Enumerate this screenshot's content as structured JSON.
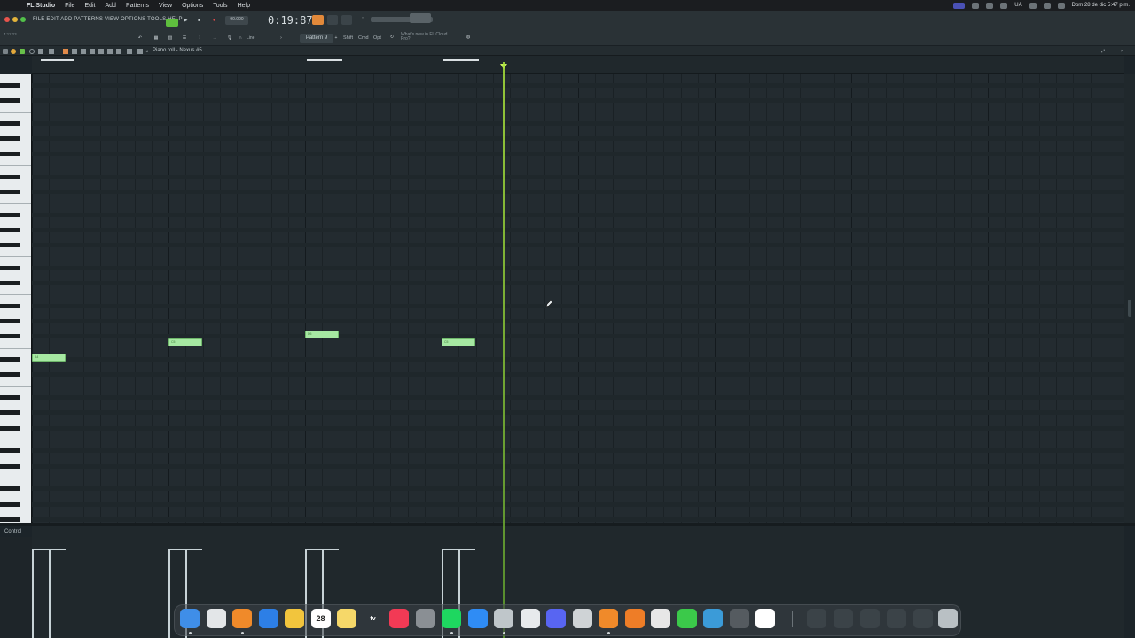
{
  "menubar": {
    "apple": "",
    "app_name": "FL Studio",
    "items": [
      "File",
      "Edit",
      "Add",
      "Patterns",
      "View",
      "Options",
      "Tools",
      "Help"
    ],
    "right_text": "UA",
    "datetime": "Dom 28 de dic 5:47 p.m."
  },
  "toolbar": {
    "fl_menu": "FILE  EDIT  ADD  PATTERNS  VIEW  OPTIONS  TOOLS  HELP",
    "tempo": "90.000",
    "time": "0:19:87",
    "snap": "Line",
    "pattern": "Pattern 9",
    "mode_shift": "Shift",
    "mode_cmd": "Cmd",
    "mode_opt": "Opt",
    "news": "What's new in FL Cloud Pro?",
    "file_path": "4:11:23"
  },
  "piano_roll": {
    "title": "Piano roll - Nexus #5",
    "control_label": "Control",
    "playhead_position_note": "bar 4.5"
  },
  "notes": [
    {
      "label": "A4",
      "start": 0
    },
    {
      "label": "C5",
      "start": 1
    },
    {
      "label": "D5",
      "start": 2
    },
    {
      "label": "C5",
      "start": 3
    }
  ],
  "dock": {
    "items": [
      "finder-icon",
      "chrome-icon",
      "fl-studio-icon",
      "app-store-icon",
      "photos-icon",
      "calendar-icon",
      "notes-icon",
      "apple-tv-icon",
      "music-icon",
      "settings-icon",
      "spotify-icon",
      "safari-icon",
      "logic-icon",
      "clock-icon",
      "discord-icon",
      "script-icon",
      "fl-studio-icon-2",
      "fl-studio-icon-3",
      "roblox-icon",
      "facetime-icon",
      "time-machine-icon",
      "app-icon",
      "activity-icon"
    ],
    "calendar_day": "28",
    "tv_label": "tv"
  }
}
